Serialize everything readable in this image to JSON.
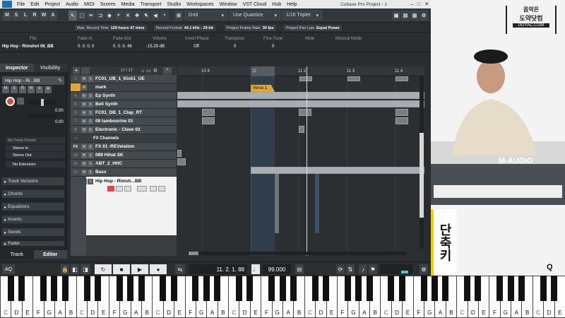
{
  "app": {
    "title": "Cubase Pro Project - 1",
    "menu": [
      "File",
      "Edit",
      "Project",
      "Audio",
      "MIDI",
      "Scores",
      "Media",
      "Transport",
      "Studio",
      "Workspaces",
      "Window",
      "VST Cloud",
      "Hub",
      "Help"
    ]
  },
  "toolbar": {
    "mode_buttons": [
      "M",
      "S",
      "L",
      "R",
      "W",
      "A"
    ],
    "grid_label": "Grid",
    "quantize_label": "Use Quantize",
    "quantize_value": "1/16 Triplet"
  },
  "status": {
    "max_record_time_label": "Max. Record Time",
    "max_record_time": "129 hours 47 mins",
    "record_format_label": "Record Format",
    "record_format": "44.1 kHz - 24 bit",
    "frame_rate_label": "Project Frame Rate",
    "frame_rate": "30 fps",
    "pan_law_label": "Project Pan Law",
    "pan_law": "Equal Power"
  },
  "infoline": {
    "headers": [
      "File",
      "Fade-In",
      "Fade-Out",
      "Volume",
      "Invert Phase",
      "Transpose",
      "Fine-Tune",
      "Mute",
      "Musical Mode"
    ],
    "values": [
      "Hip Hop - Rimshot 06_BB",
      "0. 0. 0. 0",
      "0. 0. 0. 46",
      "-15.29 dB",
      "Off",
      "0",
      "0",
      "",
      ""
    ]
  },
  "inspector": {
    "tabs": [
      "Inspector",
      "Visibility"
    ],
    "track_name": "Hip Hop - Ri...BB",
    "no_track_preset": "No Track Preset",
    "stereo_in": "Stereo In",
    "stereo_out": "Stereo Out",
    "no_extension": "No Extension",
    "vol_value": "0.00",
    "pan_value": "0.00",
    "sections": [
      "Track Versions",
      "Chords",
      "Equalizers",
      "Inserts",
      "Sends",
      "Fader"
    ],
    "bottom_tabs": [
      "Track",
      "Editor"
    ]
  },
  "tracklist": {
    "counter": "17 / 17",
    "tracks": [
      {
        "num": "1",
        "name": "FC01_UB_1_Kick1_UE"
      },
      {
        "num": "",
        "name": "mark"
      },
      {
        "num": "4",
        "name": "Ep Synth"
      },
      {
        "num": "5",
        "name": "Bell Synth"
      },
      {
        "num": "6",
        "name": "FC01_DB_1_Clap_RT"
      },
      {
        "num": "7",
        "name": "09 tambourine 01"
      },
      {
        "num": "8",
        "name": "Electronic - Clave 02"
      },
      {
        "num": "",
        "name": "FX Channels"
      },
      {
        "num": "",
        "name": "FX 01 -REVelation"
      },
      {
        "num": "10",
        "name": "089 Hihat SK"
      },
      {
        "num": "11",
        "name": "ABT_2_HHC"
      },
      {
        "num": "12",
        "name": "Bass"
      },
      {
        "num": "13",
        "name": "Hip Hop - Rimsh...BB"
      }
    ]
  },
  "arrange": {
    "ruler_labels": [
      "10 4",
      "11",
      "11 2",
      "11 3",
      "11 4"
    ],
    "marker_label": "Verse 1"
  },
  "transport": {
    "position": "11. 2. 1. 88",
    "tempo": "99.000"
  },
  "piano_keys": [
    "C",
    "D",
    "E",
    "F",
    "G",
    "A",
    "B",
    "C",
    "D",
    "E",
    "F",
    "G",
    "A",
    "B",
    "C",
    "D",
    "E",
    "F",
    "G",
    "A",
    "B",
    "C",
    "D",
    "E",
    "F",
    "G",
    "A",
    "B",
    "C",
    "D",
    "E",
    "F",
    "G",
    "A",
    "B",
    "C",
    "D",
    "E",
    "F",
    "G",
    "A",
    "B",
    "C",
    "D",
    "E",
    "F",
    "G",
    "A",
    "B",
    "C",
    "D",
    "E"
  ],
  "overlay": {
    "logo_line1": "음악은",
    "logo_line2": "도약닷컴",
    "logo_url": "DOYAC.COM",
    "caption": "단축키",
    "keyboard_brand": "M-AUDIO",
    "q_label": "Q"
  },
  "colors": {
    "daw_bg": "#2a2d30",
    "record_red": "#e04848",
    "marker_orange": "#e0a632",
    "selection_blue": "#3b4f6b"
  }
}
